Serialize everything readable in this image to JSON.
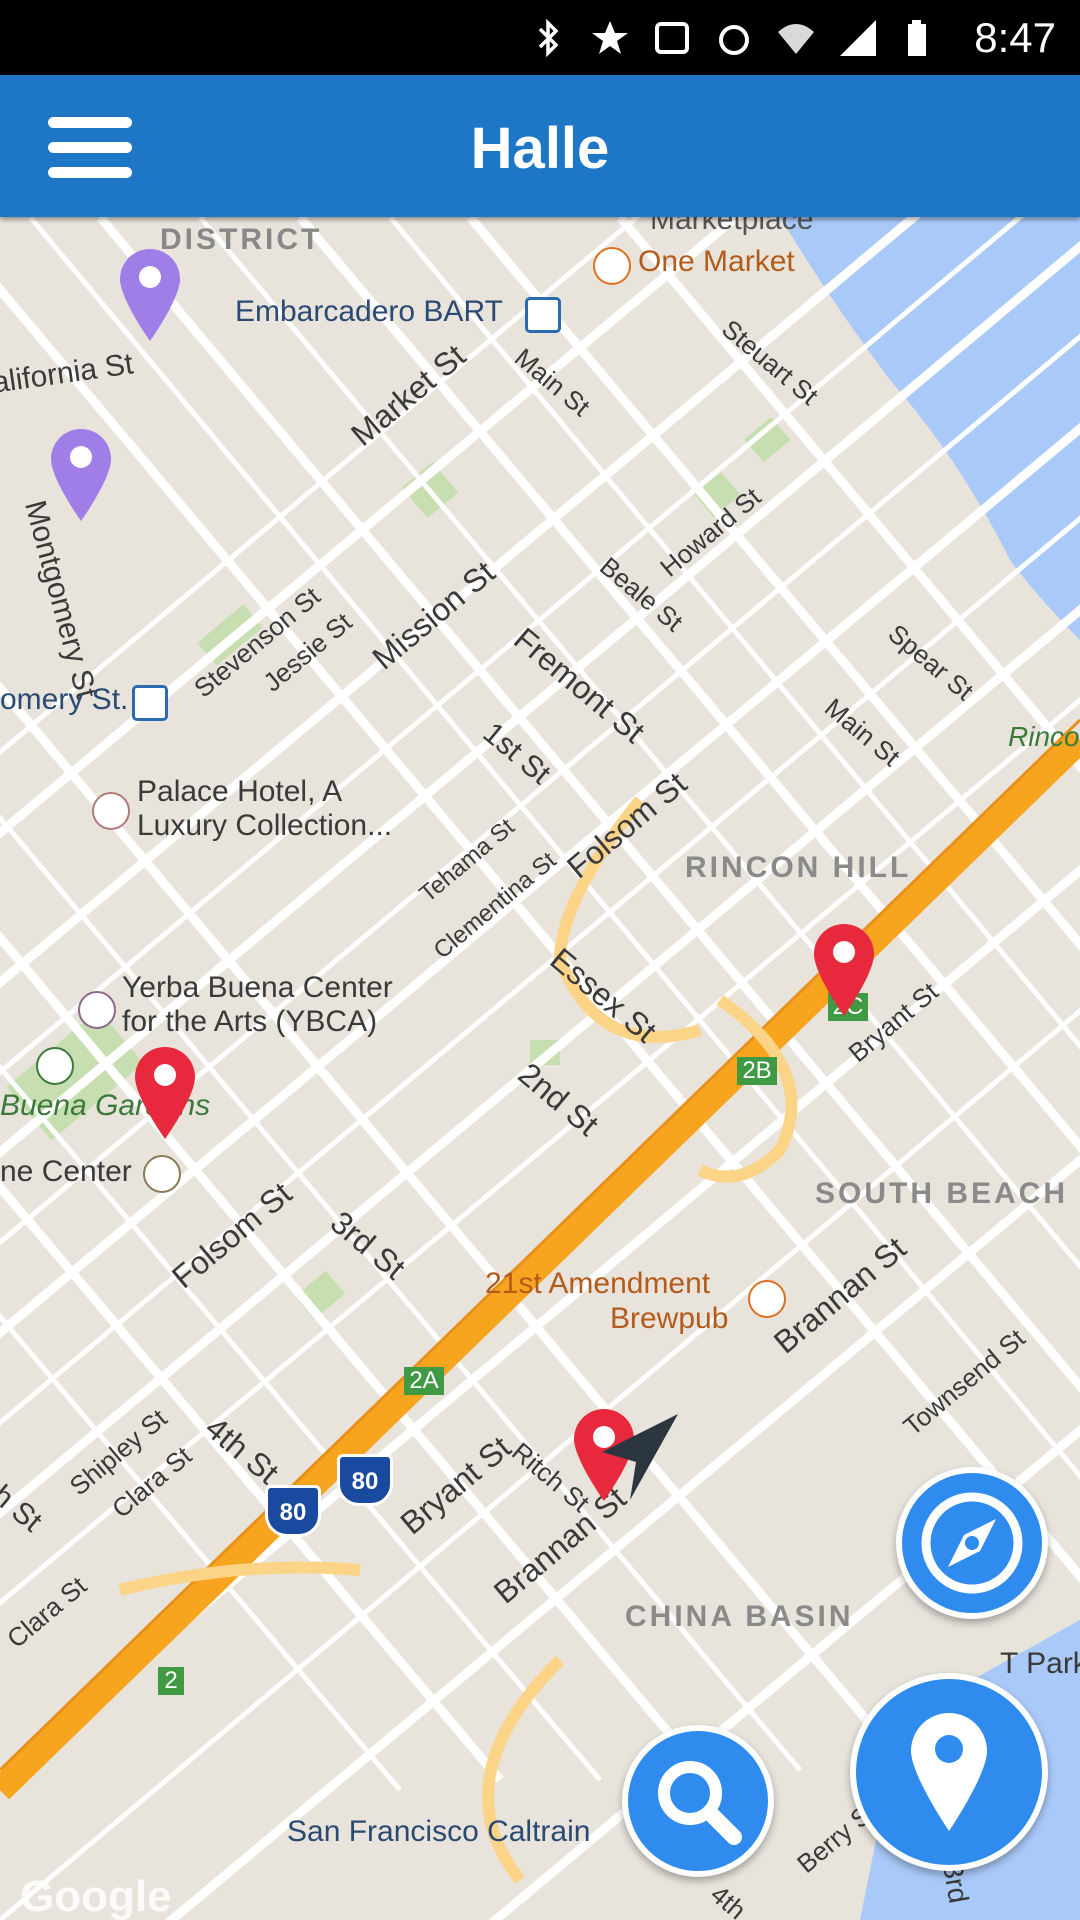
{
  "status_bar": {
    "time": "8:47"
  },
  "app_bar": {
    "title": "Halle"
  },
  "map": {
    "labels": {
      "financial_district": "DISTRICT",
      "embarcadero_bart": "Embarcadero BART",
      "one_market": "One Market",
      "marketplace": "Marketplace",
      "california_st": "alifornia St",
      "montgomery_st": "Montgomery St",
      "montgomery_st_station": "omery St.",
      "market_st": "Market St",
      "main_st_top": "Main St",
      "steuart_st": "Steuart St",
      "howard_st": "Howard St",
      "beale_st": "Beale St",
      "spear_st": "Spear St",
      "main_st": "Main St",
      "rinco": "Rinco",
      "mission_st": "Mission St",
      "stevenson_st": "Stevenson St",
      "jessie_st": "Jessie St",
      "fremont_st": "Fremont St",
      "first_st": "1st St",
      "folsom_st_right": "Folsom St",
      "tehama_st": "Tehama St",
      "clementina_st": "Clementina St",
      "rincon_hill": "RINCON HILL",
      "palace_hotel_1": "Palace Hotel, A",
      "palace_hotel_2": "Luxury Collection...",
      "ybca_1": "Yerba Buena Center",
      "ybca_2": "for the Arts (YBCA)",
      "yerba_buena_gardens": "Buena Gardens",
      "moscone_center": "ne Center",
      "essex_st": "Essex St",
      "second_st": "2nd St",
      "bryant_st_right": "Bryant St",
      "south_beach": "SOUTH BEACH",
      "folsom_st_left": "Folsom St",
      "third_st": "3rd St",
      "amendment_1": "21st Amendment",
      "amendment_2": "Brewpub",
      "brannan_st_right": "Brannan St",
      "townsend_st": "Townsend St",
      "fourth_st": "4th St",
      "shipley_st": "Shipley St",
      "clara_st": "Clara St",
      "bryant_st_left": "Bryant St",
      "ritch_st": "Ritch St",
      "brannan_st_left": "Brannan St",
      "china_basin": "CHINA BASIN",
      "park": "T Park",
      "sf_caltrain": "San Francisco Caltrain",
      "berry_st": "Berry St",
      "third_st_bottom": "3rd",
      "fourth_st_bottom": "4th",
      "fifth_st": "h St",
      "clara_st_bottom": "Clara St",
      "google": "Google"
    },
    "shields": {
      "i80_a": "80",
      "i80_b": "80"
    },
    "exits": {
      "exit_2c": "2C",
      "exit_2b": "2B",
      "exit_2a": "2A",
      "exit_2": "2"
    }
  },
  "icons": {
    "menu": "hamburger-menu-icon",
    "compass": "compass-icon",
    "search": "search-icon",
    "add_marker": "map-pin-icon",
    "location": "navigation-arrow-icon"
  },
  "colors": {
    "app_bar": "#1e76c6",
    "fab": "#2f8bee",
    "pin_red": "#e8283c",
    "pin_purple": "#a07ee8",
    "highway": "#f7a51f",
    "water": "#a9c9f8"
  }
}
